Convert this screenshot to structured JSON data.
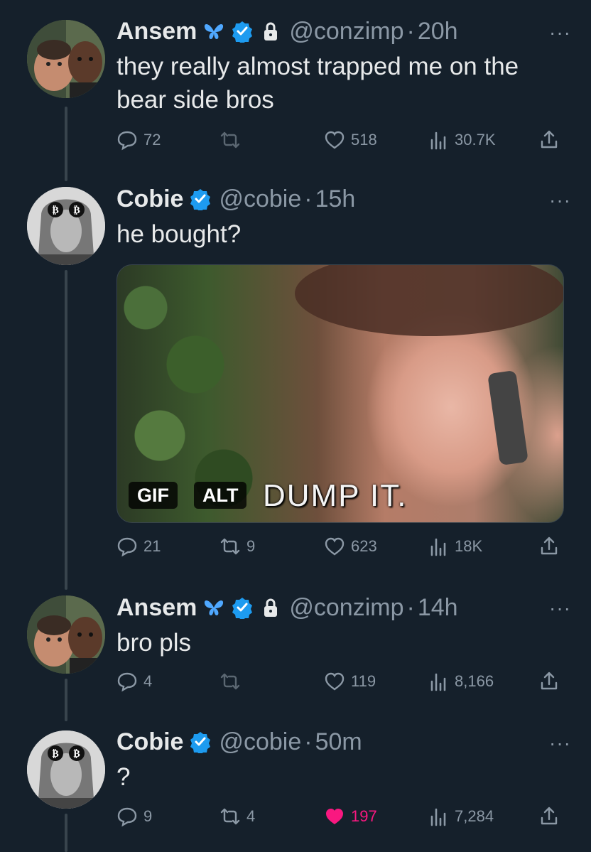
{
  "tweets": [
    {
      "name": "Ansem",
      "handle": "@conzimp",
      "sep": "·",
      "time": "20h",
      "text": "they really almost trapped me on the bear side bros",
      "more": "···",
      "replies": "72",
      "retweets": "",
      "likes": "518",
      "views": "30.7K"
    },
    {
      "name": "Cobie",
      "handle": "@cobie",
      "sep": "·",
      "time": "15h",
      "text": "he bought?",
      "more": "···",
      "media": {
        "gif_label": "GIF",
        "alt_label": "ALT",
        "caption": "DUMP IT."
      },
      "replies": "21",
      "retweets": "9",
      "likes": "623",
      "views": "18K"
    },
    {
      "name": "Ansem",
      "handle": "@conzimp",
      "sep": "·",
      "time": "14h",
      "text": "bro pls",
      "more": "···",
      "replies": "4",
      "retweets": "",
      "likes": "119",
      "views": "8,166"
    },
    {
      "name": "Cobie",
      "handle": "@cobie",
      "sep": "·",
      "time": "50m",
      "text": "?",
      "more": "···",
      "replies": "9",
      "retweets": "4",
      "likes": "197",
      "views": "7,284"
    }
  ],
  "colors": {
    "background": "#15202b",
    "secondary_text": "#8b98a5",
    "verified_blue": "#1d9bf0",
    "liked_pink": "#f91880",
    "butterfly_blue": "#4fa8ff"
  }
}
